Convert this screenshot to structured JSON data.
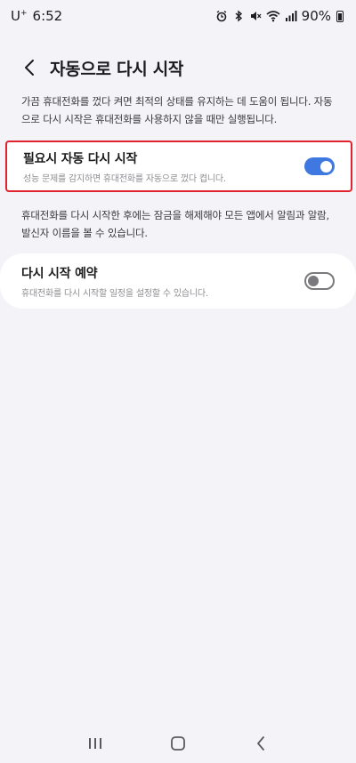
{
  "status_bar": {
    "carrier": "U",
    "carrier_sup": "+",
    "time": "6:52",
    "battery": "90%"
  },
  "header": {
    "title": "자동으로 다시 시작"
  },
  "description_top": "가끔 휴대전화를 껐다 켜면 최적의 상태를 유지하는 데 도움이 됩니다. 자동으로 다시 시작은 휴대전화를 사용하지 않을 때만 실행됩니다.",
  "auto_restart": {
    "title": "필요시 자동 다시 시작",
    "subtitle": "성능 문제를 감지하면 휴대전화를 자동으로 껐다 켭니다.",
    "enabled": true
  },
  "description_mid": "휴대전화를 다시 시작한 후에는 잠금을 해제해야 모든 앱에서 알림과 알람, 발신자 이름을 볼 수 있습니다.",
  "scheduled_restart": {
    "title": "다시 시작 예약",
    "subtitle": "휴대전화를 다시 시작할 일정을 설정할 수 있습니다.",
    "enabled": false
  },
  "colors": {
    "accent": "#3f78e0",
    "highlight_border": "#e0232e",
    "background": "#f4f3f8"
  },
  "icons": {
    "back": "chevron-left-icon",
    "alarm": "alarm-icon",
    "bluetooth": "bluetooth-icon",
    "mute": "mute-icon",
    "wifi": "wifi-icon",
    "signal": "signal-icon",
    "battery": "battery-icon",
    "nav_recents": "recents-icon",
    "nav_home": "home-icon",
    "nav_back": "back-icon"
  }
}
